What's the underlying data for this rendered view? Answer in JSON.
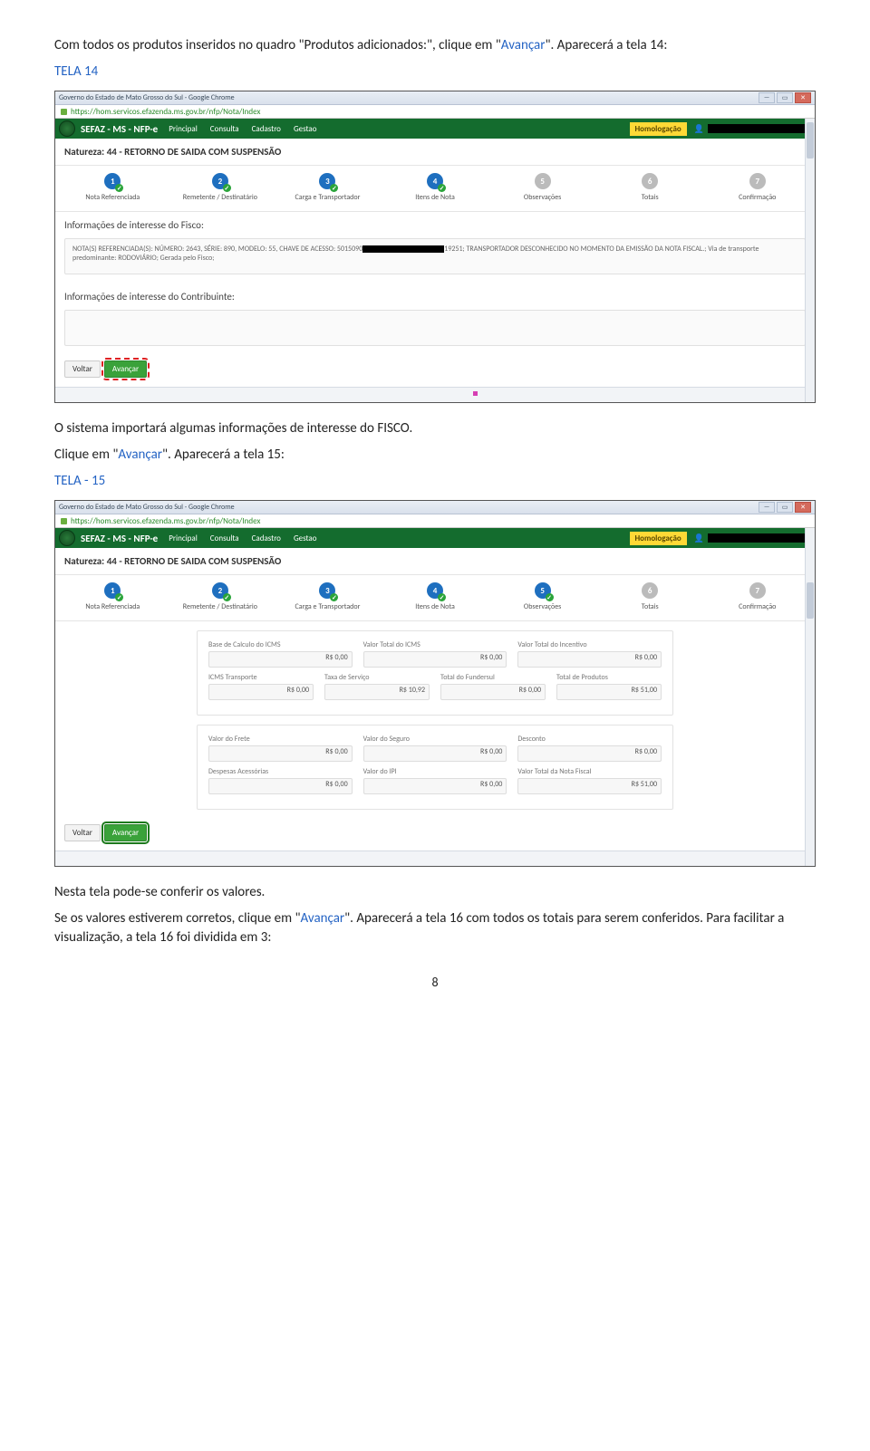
{
  "intro": {
    "line1a": "Com todos os produtos inseridos no quadro \"Produtos adicionados:\", clique em \"",
    "link1": "Avançar",
    "line1b": "\". Aparecerá a tela 14:",
    "tela14": "TELA 14"
  },
  "chrome": {
    "title": "Governo do Estado de Mato Grosso do Sul - Google Chrome",
    "url": "https://hom.servicos.efazenda.ms.gov.br/nfp/Nota/Index"
  },
  "topbar": {
    "app": "SEFAZ - MS - NFP-e",
    "nav": [
      "Principal",
      "Consulta",
      "Cadastro",
      "Gestao"
    ],
    "homolog": "Homologação"
  },
  "natureza": "Natureza: 44 - RETORNO DE SAIDA COM SUSPENSÃO",
  "steps": {
    "labels": [
      "Nota Referenciada",
      "Remetente / Destinatário",
      "Carga e Transportador",
      "Itens de Nota",
      "Observações",
      "Totais",
      "Confirmação"
    ]
  },
  "s14": {
    "h1": "Informações de interesse do Fisco:",
    "box_a": "NOTA(S) REFERENCIADA(S): NÚMERO: 2643, SÉRIE: 890, MODELO: 55, CHAVE DE ACESSO: 5015090",
    "box_b": "19251; TRANSPORTADOR DESCONHECIDO NO MOMENTO DA EMISSÃO DA NOTA FISCAL.; Via de transporte predominante: RODOVIÁRIO; Gerada pelo Fisco;",
    "h2": "Informações de interesse do Contribuinte:"
  },
  "btns": {
    "voltar": "Voltar",
    "avancar": "Avançar"
  },
  "mid": {
    "p1": "O sistema importará algumas informações de interesse do FISCO.",
    "p2a": "Clique em \"",
    "p2link": "Avançar",
    "p2b": "\". Aparecerá a tela 15:",
    "tela15": "TELA - 15"
  },
  "s15": {
    "fields1": [
      {
        "label": "Base de Calculo do ICMS",
        "value": "R$ 0,00"
      },
      {
        "label": "Valor Total do ICMS",
        "value": "R$ 0,00"
      },
      {
        "label": "Valor Total do Incentivo",
        "value": "R$ 0,00"
      }
    ],
    "fields2": [
      {
        "label": "ICMS Transporte",
        "value": "R$ 0,00"
      },
      {
        "label": "Taxa de Serviço",
        "value": "R$ 10,92"
      },
      {
        "label": "Total do Fundersul",
        "value": "R$ 0,00"
      },
      {
        "label": "Total de Produtos",
        "value": "R$ 51,00"
      }
    ],
    "fields3": [
      {
        "label": "Valor do Frete",
        "value": "R$ 0,00"
      },
      {
        "label": "Valor do Seguro",
        "value": "R$ 0,00"
      },
      {
        "label": "Desconto",
        "value": "R$ 0,00"
      }
    ],
    "fields4": [
      {
        "label": "Despesas Acessórias",
        "value": "R$ 0,00"
      },
      {
        "label": "Valor do IPI",
        "value": "R$ 0,00"
      },
      {
        "label": "Valor Total da Nota Fiscal",
        "value": "R$ 51,00"
      }
    ]
  },
  "outro": {
    "p1": "Nesta tela pode-se conferir os valores.",
    "p2a": "Se os valores estiverem corretos, clique em \"",
    "p2link": "Avançar",
    "p2b": "\". Aparecerá a tela 16 com todos os totais para serem conferidos. Para facilitar a visualização, a tela 16 foi dividida em 3:"
  },
  "page": "8"
}
